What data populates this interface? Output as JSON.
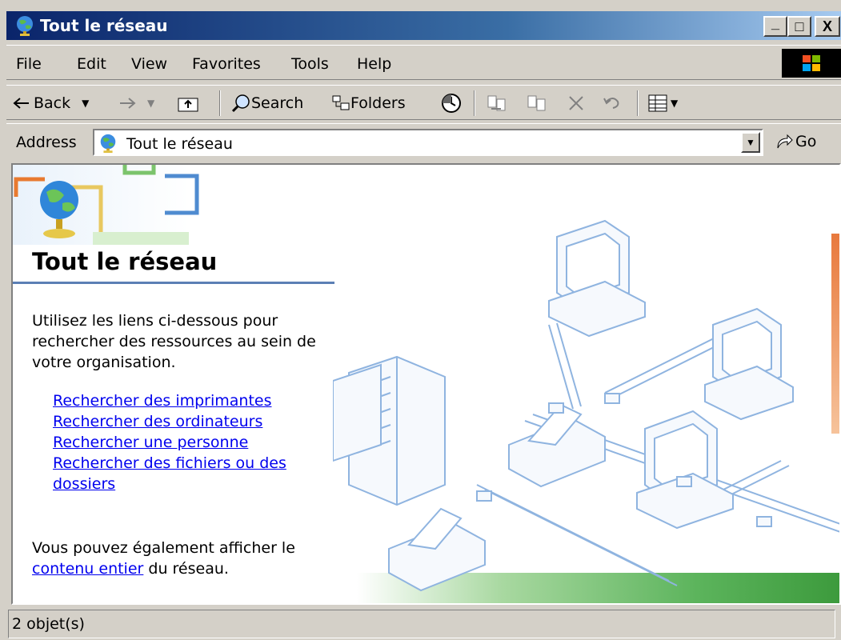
{
  "window": {
    "title": "Tout le réseau",
    "controls": {
      "minimize": "_",
      "maximize": "□",
      "close": "X"
    }
  },
  "menubar": {
    "items": [
      {
        "label": "File"
      },
      {
        "label": "Edit"
      },
      {
        "label": "View"
      },
      {
        "label": "Favorites"
      },
      {
        "label": "Tools"
      },
      {
        "label": "Help"
      }
    ]
  },
  "toolbar": {
    "back_label": "Back",
    "search_label": "Search",
    "folders_label": "Folders"
  },
  "address": {
    "label": "Address",
    "value": "Tout le réseau",
    "go_label": "Go"
  },
  "content": {
    "heading": "Tout le réseau",
    "intro": "Utilisez les liens ci-dessous pour rechercher des ressources au sein de votre organisation.",
    "links": [
      {
        "label": "Rechercher des imprimantes"
      },
      {
        "label": "Rechercher des ordinateurs"
      },
      {
        "label": "Rechercher une personne"
      },
      {
        "label": "Rechercher des fichiers ou des dossiers"
      }
    ],
    "more_prefix": "Vous pouvez également afficher le ",
    "more_link": "contenu entier",
    "more_suffix": " du réseau."
  },
  "status": {
    "text": "2 objet(s)"
  },
  "colors": {
    "titlebar_start": "#0a246a",
    "titlebar_end": "#a6caf0",
    "link": "#0000ee",
    "chrome": "#d4d0c8"
  }
}
